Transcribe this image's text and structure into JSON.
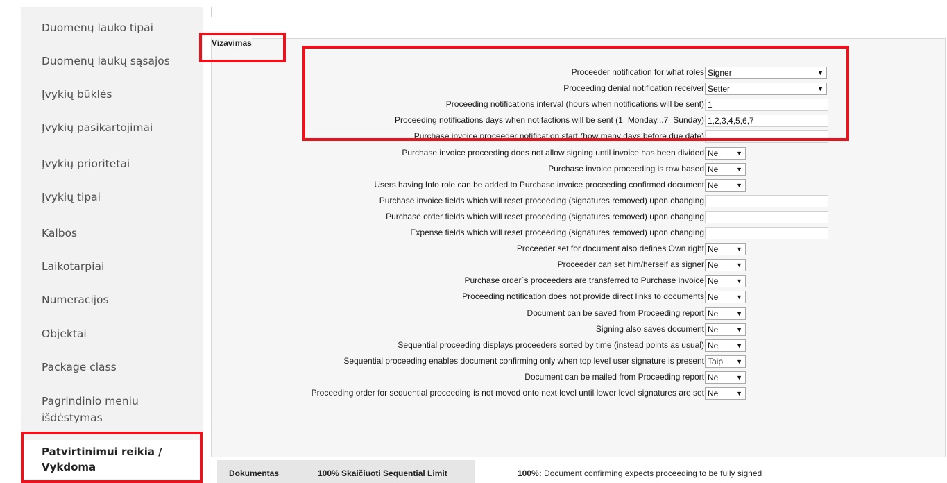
{
  "sidebar": {
    "items": [
      {
        "label": "Duomenų lauko tipai"
      },
      {
        "label": "Duomenų laukų sąsajos"
      },
      {
        "label": "Įvykių būklės"
      },
      {
        "label": "Įvykių pasikartojimai"
      },
      {
        "label": "Įvykių prioritetai"
      },
      {
        "label": "Įvykių tipai"
      },
      {
        "label": "Kalbos"
      },
      {
        "label": "Laikotarpiai"
      },
      {
        "label": "Numeracijos"
      },
      {
        "label": "Objektai"
      },
      {
        "label": "Package class"
      },
      {
        "label_line1": "Pagrindinio meniu",
        "label_line2": "išdėstymas"
      },
      {
        "label_line1": "Patvirtinimui reikia /",
        "label_line2": "Vykdoma"
      }
    ]
  },
  "section": {
    "legend": "Vizavimas"
  },
  "settings": [
    {
      "label": "Proceeder notification for what roles",
      "type": "select",
      "value": "Signer"
    },
    {
      "label": "Proceeding denial notification receiver",
      "type": "select",
      "value": "Setter"
    },
    {
      "label": "Proceeding notifications interval (hours when notifications will be sent)",
      "type": "input",
      "value": "1"
    },
    {
      "label": "Proceeding notifications days when notifactions will be sent (1=Monday...7=Sunday)",
      "type": "input",
      "value": "1,2,3,4,5,6,7"
    },
    {
      "label": "Purchase invoice proceeder notification start (how many days before due date)",
      "type": "input",
      "value": ""
    },
    {
      "label": "Purchase invoice proceeding does not allow signing until invoice has been divided",
      "type": "select",
      "value": "Ne"
    },
    {
      "label": "Purchase invoice proceeding is row based",
      "type": "select",
      "value": "Ne"
    },
    {
      "label": "Users having Info role can be added to Purchase invoice proceeding confirmed document",
      "type": "select",
      "value": "Ne"
    },
    {
      "label": "Purchase invoice fields which will reset proceeding (signatures removed) upon changing",
      "type": "input",
      "value": ""
    },
    {
      "label": "Purchase order fields which will reset proceeding (signatures removed) upon changing",
      "type": "input",
      "value": ""
    },
    {
      "label": "Expense fields which will reset proceeding (signatures removed) upon changing",
      "type": "input",
      "value": ""
    },
    {
      "label": "Proceeder set for document also defines Own right",
      "type": "select",
      "value": "Ne"
    },
    {
      "label": "Proceeder can set him/herself as signer",
      "type": "select",
      "value": "Ne"
    },
    {
      "label": "Purchase order´s proceeders are transferred to Purchase invoice",
      "type": "select",
      "value": "Ne"
    },
    {
      "label": "Proceeding notification does not provide direct links to documents",
      "type": "select",
      "value": "Ne"
    },
    {
      "label": "Document can be saved from Proceeding report",
      "type": "select",
      "value": "Ne"
    },
    {
      "label": "Signing also saves document",
      "type": "select",
      "value": "Ne"
    },
    {
      "label": "Sequential proceeding displays proceeders sorted by time (instead points as usual)",
      "type": "select",
      "value": "Ne"
    },
    {
      "label": "Sequential proceeding enables document confirming only when top level user signature is present",
      "type": "select",
      "value": "Taip"
    },
    {
      "label": "Document can be mailed from Proceeding report",
      "type": "select",
      "value": "Ne"
    },
    {
      "label": "Proceeding order for sequential proceeding is not moved onto next level until lower level signatures are set",
      "type": "select",
      "value": "Ne"
    }
  ],
  "bottom_table": {
    "col1": "Dokumentas",
    "col2": "100% Skaičiuoti Sequential Limit"
  },
  "note": {
    "bold": "100%:",
    "text": " Document confirming expects proceeding to be fully signed"
  },
  "colors": {
    "highlight": "#e8141d",
    "sidebar_bg": "#f2f2f2",
    "panel_bg": "#f6f6f6"
  }
}
